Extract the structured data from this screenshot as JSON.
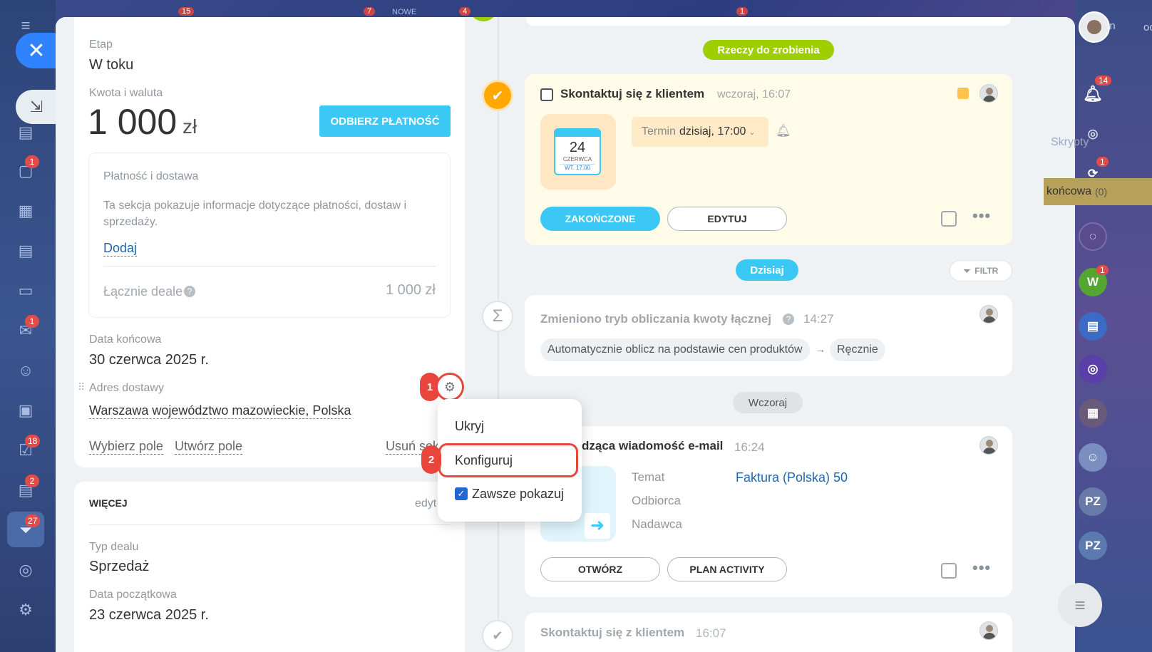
{
  "top_strip": {
    "badge_a": "15",
    "badge_b": "7",
    "label_new": "NOWE",
    "badge_c": "4",
    "badge_d": "1"
  },
  "left_sidebar": {
    "badges": {
      "chat": "1",
      "mail": "1",
      "tasks": "18",
      "crm": "2",
      "funnel": "27"
    }
  },
  "deal": {
    "stage_label": "Etap",
    "stage_value": "W toku",
    "amount_label": "Kwota i waluta",
    "amount_value": "1 000",
    "currency": "zł",
    "receive_payment": "ODBIERZ PŁATNOŚĆ",
    "payment_title": "Płatność i dostawa",
    "payment_desc": "Ta sekcja pokazuje informacje dotyczące płatności, dostaw i sprzedaży.",
    "payment_add": "Dodaj",
    "total_label": "Łącznie deale",
    "total_value": "1 000 zł",
    "end_date_label": "Data końcowa",
    "end_date_value": "30 czerwca 2025 r.",
    "address_label": "Adres dostawy",
    "address_value": "Warszawa województwo mazowieckie, Polska",
    "choose_field": "Wybierz pole",
    "create_field": "Utwórz pole",
    "delete_section": "Usuń sek"
  },
  "more": {
    "title": "WIĘCEJ",
    "edit": "edyt",
    "type_label": "Typ dealu",
    "type_value": "Sprzedaż",
    "start_label": "Data początkowa",
    "start_value": "23 czerwca 2025 r."
  },
  "context_menu": {
    "hide": "Ukryj",
    "configure": "Konfiguruj",
    "always_show": "Zawsze pokazuj",
    "step1": "1",
    "step2": "2"
  },
  "timeline": {
    "todo_pill": "Rzeczy do zrobienia",
    "task_title": "Skontaktuj się z klientem",
    "task_time": "wczoraj, 16:07",
    "cal_day": "24",
    "cal_month": "CZERWCA",
    "cal_sub": "WT. 17:00",
    "deadline_label": "Termin",
    "deadline_value": "dzisiaj, 17:00",
    "done_btn": "ZAKOŃCZONE",
    "edit_btn": "EDYTUJ",
    "today_pill": "Dzisiaj",
    "filter": "FILTR",
    "change_title": "Zmieniono tryb obliczania kwoty łącznej",
    "change_time": "14:27",
    "from_mode": "Automatycznie oblicz na podstawie cen produktów",
    "to_mode": "Ręcznie",
    "yesterday_pill": "Wczoraj",
    "email_title": "dząca wiadomość e-mail",
    "email_time": "16:24",
    "subject_label": "Temat",
    "subject_value": "Faktura (Polska) 50",
    "recipient_label": "Odbiorca",
    "sender_label": "Nadawca",
    "open_btn": "OTWÓRZ",
    "plan_btn": "PLAN ACTIVITY",
    "bottom_title": "Skontaktuj się z klientem",
    "bottom_time": "16:07"
  },
  "right_sidebar": {
    "notif_badge": "14",
    "scripts": "Skrypty",
    "chat_badge": "1",
    "final_label": "końcowa",
    "final_count": "(0)",
    "w_avatar": "W",
    "w_badge": "1",
    "pz1": "PZ",
    "pz2": "PZ",
    "top_text": "oc",
    "an_text": "an"
  },
  "colors": {
    "accent": "#3bc8f5",
    "green": "#9dcf00",
    "orange": "#ffa900",
    "red": "#e8463c"
  }
}
